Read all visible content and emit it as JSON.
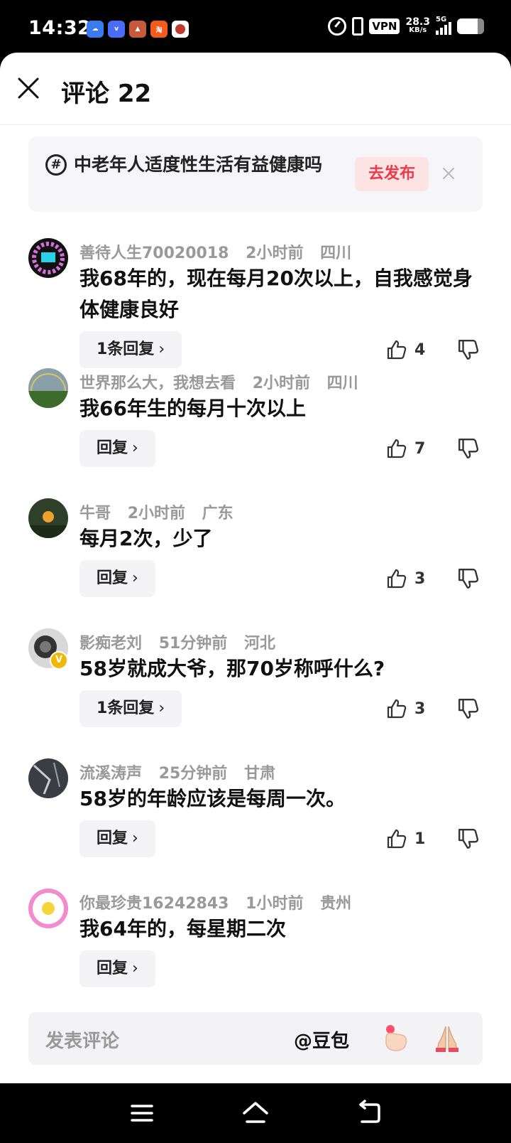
{
  "status_bar": {
    "time": "14:32",
    "vpn": "VPN",
    "net_speed_value": "28.3",
    "net_speed_unit": "KB/s",
    "network": "5G",
    "notification_icons": [
      "cloud-app-icon",
      "vivo-icon",
      "game-icon",
      "taobao-icon",
      "avatar-app-icon"
    ]
  },
  "header": {
    "title": "评论 22"
  },
  "topic": {
    "text": "中老年人适度性生活有益健康吗",
    "publish_label": "去发布"
  },
  "comments": [
    {
      "user": "善待人生70020018",
      "time": "2小时前",
      "location": "四川",
      "content": "我68年的，现在每月20次以上，自我感觉身体健康良好",
      "reply_label": "1条回复",
      "likes": "4"
    },
    {
      "user": "世界那么大，我想去看",
      "time": "2小时前",
      "location": "四川",
      "content": "我66年生的每月十次以上",
      "reply_label": "回复",
      "likes": "7"
    },
    {
      "user": "牛哥",
      "time": "2小时前",
      "location": "广东",
      "content": "每月2次，少了",
      "reply_label": "回复",
      "likes": "3"
    },
    {
      "user": "影痴老刘",
      "time": "51分钟前",
      "location": "河北",
      "content": "58岁就成大爷，那70岁称呼什么?",
      "reply_label": "1条回复",
      "likes": "3"
    },
    {
      "user": "流溪涛声",
      "time": "25分钟前",
      "location": "甘肃",
      "content": "58岁的年龄应该是每周一次。",
      "reply_label": "回复",
      "likes": "1"
    },
    {
      "user": "你最珍贵16242843",
      "time": "1小时前",
      "location": "贵州",
      "content": "我64年的，每星期二次",
      "reply_label": "回复",
      "likes": ""
    }
  ],
  "input_bar": {
    "placeholder": "发表评论",
    "mention": "@豆包"
  },
  "colors": {
    "accent": "#ec3a4a",
    "publish_bg": "#fde4e4",
    "meta_gray": "#999999",
    "verified": "#f2b705"
  }
}
